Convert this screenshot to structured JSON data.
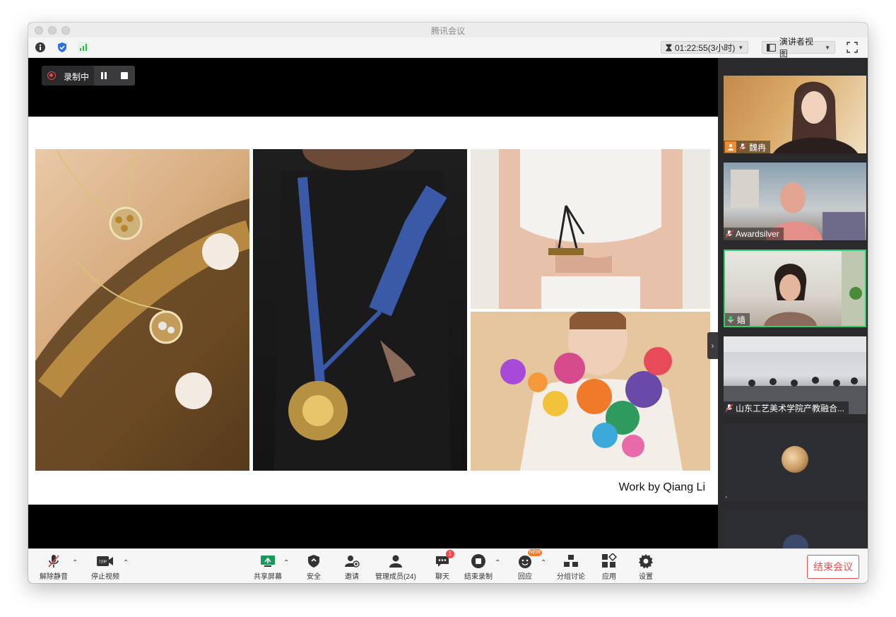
{
  "window": {
    "title": "腾讯会议"
  },
  "topbar": {
    "icons": [
      "info-icon",
      "shield-icon",
      "signal-icon"
    ],
    "timer": "01:22:55(3小时)",
    "view_mode": "演讲者视图",
    "fullscreen_icon": "fullscreen-icon"
  },
  "recording": {
    "status": "录制中",
    "pause_icon": "pause-icon",
    "stop_icon": "stop-icon",
    "color": "#e24a4a"
  },
  "slide": {
    "caption": "Work by Qiang Li"
  },
  "participants": [
    {
      "name": "魏冉",
      "mic": "mic-icon",
      "host": true
    },
    {
      "name": "Awardsilver",
      "mic": "mic-icon"
    },
    {
      "name": "嫱",
      "mic": "mic-active-icon",
      "active": true
    },
    {
      "name": "山东工艺美术学院产教融合...",
      "mic": "mic-icon"
    },
    {
      "name": ".",
      "avatar": true
    },
    {
      "name": ""
    }
  ],
  "toolbar": {
    "unmute": "解除静音",
    "stop_video": "停止视频",
    "share_screen": "共享屏幕",
    "security": "安全",
    "invite": "邀请",
    "members": "管理成员(24)",
    "chat": "聊天",
    "chat_badge": "1",
    "end_recording": "结束录制",
    "react": "回应",
    "react_badge": "NEW",
    "breakout": "分组讨论",
    "apps": "应用",
    "settings": "设置",
    "end_meeting": "结束会议",
    "video_badge": "720P"
  },
  "colors": {
    "active_speaker": "#2fcf6f",
    "end_button": "#e15252",
    "signal": "#2fb84a",
    "shield": "#2f6fe0"
  }
}
